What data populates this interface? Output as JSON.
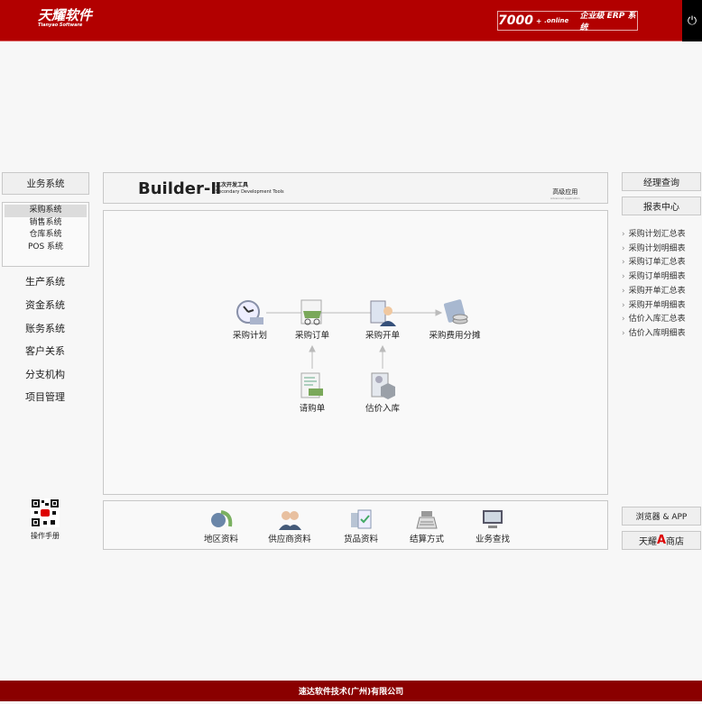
{
  "header": {
    "logo_cn": "天耀软件",
    "logo_en": "Tianyao Software",
    "product_num": "7000",
    "product_sup": "+",
    "product_suffix": ".online",
    "product_label": "企业级 ERP 系统",
    "power_icon": "power-icon"
  },
  "left": {
    "main_button": "业务系统",
    "submenu": [
      "采购系统",
      "销售系统",
      "仓库系统",
      "POS 系统"
    ],
    "nav": [
      "生产系统",
      "资金系统",
      "账务系统",
      "客户关系",
      "分支机构",
      "项目管理"
    ],
    "manual_label": "操作手册"
  },
  "banner": {
    "title": "Builder-Ⅱ",
    "subtitle_cn": "二次开发工具",
    "subtitle_en": "Secondary Development Tools",
    "advanced_cn": "高级应用",
    "advanced_en": "Advanced Application"
  },
  "flow": {
    "nodes": [
      "采购计划",
      "采购订单",
      "采购开单",
      "采购费用分摊",
      "请购单",
      "估价入库"
    ]
  },
  "bottom": {
    "items": [
      "地区资料",
      "供应商资料",
      "货品资料",
      "结算方式",
      "业务查找"
    ]
  },
  "right": {
    "buttons": [
      "经理查询",
      "报表中心"
    ],
    "links": [
      "采购计划汇总表",
      "采购计划明细表",
      "采购订单汇总表",
      "采购订单明细表",
      "采购开单汇总表",
      "采购开单明细表",
      "估价入库汇总表",
      "估价入库明细表"
    ],
    "browser_button": "浏览器 & APP",
    "store_pre": "天耀",
    "store_mark": "A",
    "store_post": "商店"
  },
  "footer": {
    "company": "速达软件技术(广州)有限公司"
  },
  "colors": {
    "brand": "#b20000",
    "footer": "#8a0000"
  }
}
